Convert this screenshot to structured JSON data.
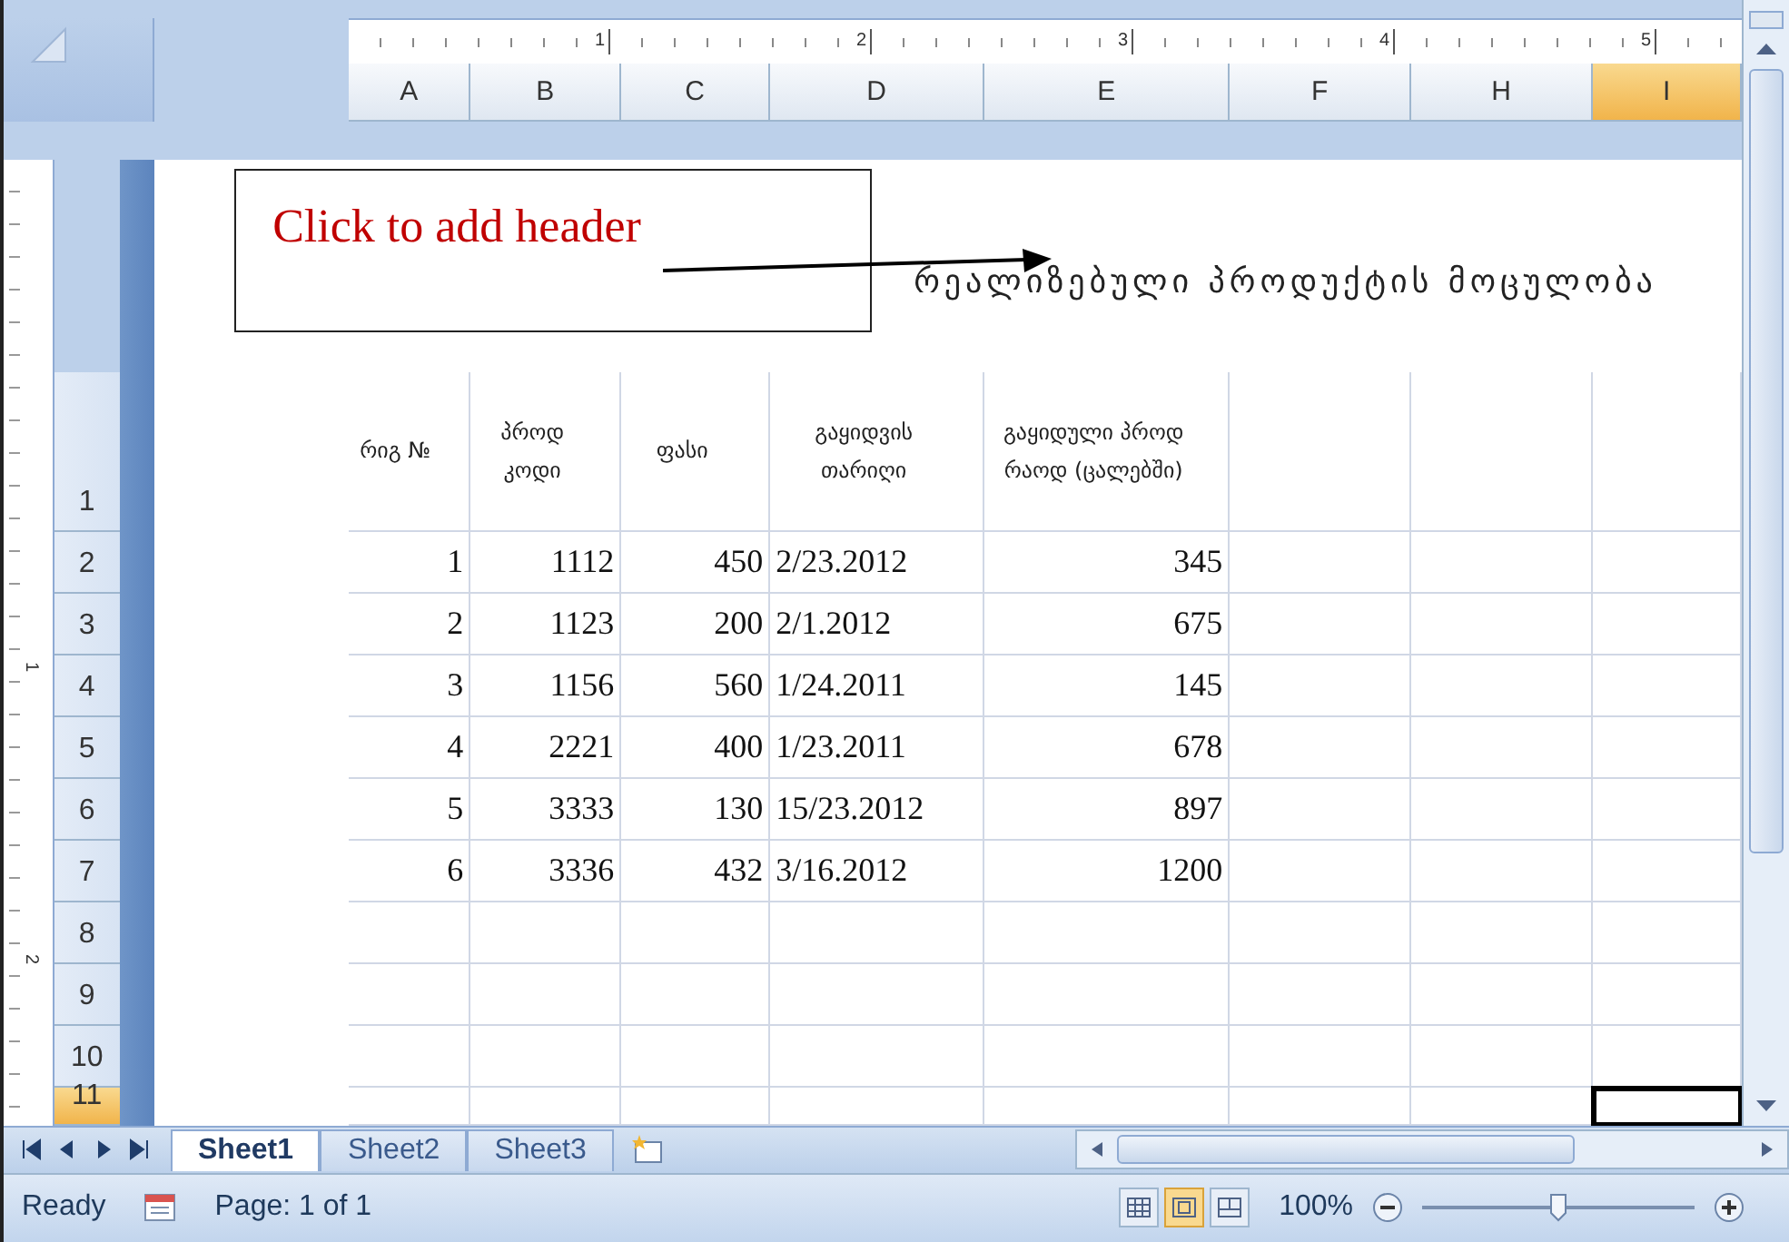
{
  "ruler": {
    "top_marks": [
      "1",
      "2",
      "3",
      "4",
      "5"
    ],
    "side_marks": [
      "1",
      "2"
    ]
  },
  "columns": [
    {
      "label": "A",
      "selected": false
    },
    {
      "label": "B",
      "selected": false
    },
    {
      "label": "C",
      "selected": false
    },
    {
      "label": "D",
      "selected": false
    },
    {
      "label": "E",
      "selected": false
    },
    {
      "label": "F",
      "selected": false
    },
    {
      "label": "H",
      "selected": false
    },
    {
      "label": "I",
      "selected": true
    }
  ],
  "page_header": {
    "placeholder": "Click to add header",
    "title": "რეალიზებული პროდუქტის მოცულობა"
  },
  "rows": [
    {
      "number": "1",
      "selected": false,
      "kind": "header",
      "cells": [
        "რიგ №",
        "პროდ კოდი",
        "ფასი",
        "გაყიდვის თარიღი",
        "გაყიდული პროდ რაოდ (ცალებში)"
      ]
    },
    {
      "number": "2",
      "selected": false,
      "kind": "data",
      "cells": [
        "1",
        "1112",
        "450",
        "2/23.2012",
        "345"
      ]
    },
    {
      "number": "3",
      "selected": false,
      "kind": "data",
      "cells": [
        "2",
        "1123",
        "200",
        "2/1.2012",
        "675"
      ]
    },
    {
      "number": "4",
      "selected": false,
      "kind": "data",
      "cells": [
        "3",
        "1156",
        "560",
        "1/24.2011",
        "145"
      ]
    },
    {
      "number": "5",
      "selected": false,
      "kind": "data",
      "cells": [
        "4",
        "2221",
        "400",
        "1/23.2011",
        "678"
      ]
    },
    {
      "number": "6",
      "selected": false,
      "kind": "data",
      "cells": [
        "5",
        "3333",
        "130",
        "15/23.2012",
        "897"
      ]
    },
    {
      "number": "7",
      "selected": false,
      "kind": "data",
      "cells": [
        "6",
        "3336",
        "432",
        "3/16.2012",
        "1200"
      ]
    },
    {
      "number": "8",
      "selected": false,
      "kind": "data"
    },
    {
      "number": "9",
      "selected": false,
      "kind": "data"
    },
    {
      "number": "10",
      "selected": false,
      "kind": "data"
    },
    {
      "number": "11",
      "selected": true,
      "kind": "data"
    }
  ],
  "sheet_tabs": [
    {
      "label": "Sheet1",
      "selected": true
    },
    {
      "label": "Sheet2",
      "selected": false
    },
    {
      "label": "Sheet3",
      "selected": false
    }
  ],
  "status_bar": {
    "state": "Ready",
    "page": "Page: 1 of 1",
    "zoom": "100%",
    "level": 0.5,
    "views": [
      {
        "kind": "normal",
        "selected": false
      },
      {
        "kind": "page-layout",
        "selected": true
      },
      {
        "kind": "page-break",
        "selected": false
      }
    ]
  }
}
